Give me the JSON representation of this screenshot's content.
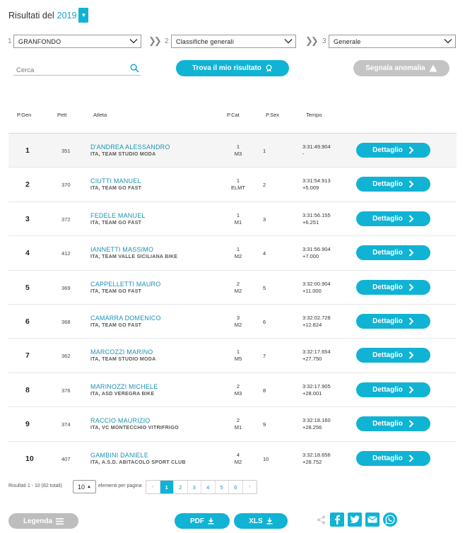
{
  "header": {
    "title": "Risultati del",
    "year": "2019"
  },
  "filters": [
    {
      "step": "1",
      "value": "GRANFONDO"
    },
    {
      "step": "2",
      "value": "Classifiche generali"
    },
    {
      "step": "3",
      "value": "Generale"
    }
  ],
  "search": {
    "placeholder": "Cerca"
  },
  "actions": {
    "find_label": "Trova il mio risultato",
    "report_label": "Segnala anomalia"
  },
  "columns": {
    "pgen": "P.Gen",
    "pett": "Pett",
    "athlete": "Atleta",
    "pcat": "P.Cat",
    "psex": "P.Sex",
    "time": "Tempo"
  },
  "rows": [
    {
      "pos": "1",
      "pett": "351",
      "name": "D'ANDREA ALESSANDRO",
      "team": "ITA, TEAM STUDIO MODA",
      "pcat": "1",
      "cat": "M3",
      "psex": "1",
      "time": "3:31:49.904",
      "gap": "-"
    },
    {
      "pos": "2",
      "pett": "370",
      "name": "CIUTTI MANUEL",
      "team": "ITA, TEAM GO FAST",
      "pcat": "1",
      "cat": "ELMT",
      "psex": "2",
      "time": "3:31:54.913",
      "gap": "+5.009"
    },
    {
      "pos": "3",
      "pett": "372",
      "name": "FEDELE MANUEL",
      "team": "ITA, TEAM GO FAST",
      "pcat": "1",
      "cat": "M1",
      "psex": "3",
      "time": "3:31:56.155",
      "gap": "+6.251"
    },
    {
      "pos": "4",
      "pett": "412",
      "name": "IANNETTI MASSIMO",
      "team": "ITA, TEAM VALLE SICILIANA BIKE",
      "pcat": "1",
      "cat": "M2",
      "psex": "4",
      "time": "3:31:56.904",
      "gap": "+7.000"
    },
    {
      "pos": "5",
      "pett": "369",
      "name": "CAPPELLETTI MAURO",
      "team": "ITA, TEAM GO FAST",
      "pcat": "2",
      "cat": "M2",
      "psex": "5",
      "time": "3:32:00.904",
      "gap": "+11.000"
    },
    {
      "pos": "6",
      "pett": "368",
      "name": "CAMARRA DOMENICO",
      "team": "ITA, TEAM GO FAST",
      "pcat": "3",
      "cat": "M2",
      "psex": "6",
      "time": "3:32:02.728",
      "gap": "+12.824"
    },
    {
      "pos": "7",
      "pett": "362",
      "name": "MARCOZZI MARINO",
      "team": "ITA, TEAM STUDIO MODA",
      "pcat": "1",
      "cat": "M5",
      "psex": "7",
      "time": "3:32:17.654",
      "gap": "+27.750"
    },
    {
      "pos": "8",
      "pett": "376",
      "name": "MARINOZZI MICHELE",
      "team": "ITA, ASD VEREGRA BIKE",
      "pcat": "2",
      "cat": "M3",
      "psex": "8",
      "time": "3:32:17.905",
      "gap": "+28.001"
    },
    {
      "pos": "9",
      "pett": "374",
      "name": "RACCIO MAURIZIO",
      "team": "ITA, VC MONTECCHIO VITRIFRIGO",
      "pcat": "2",
      "cat": "M1",
      "psex": "9",
      "time": "3:32:18.160",
      "gap": "+28.256"
    },
    {
      "pos": "10",
      "pett": "407",
      "name": "GAMBINI DANIELE",
      "team": "ITA, A.S.D. ABITACOLO SPORT CLUB",
      "pcat": "4",
      "cat": "M2",
      "psex": "10",
      "time": "3:32:18.656",
      "gap": "+28.752"
    }
  ],
  "detail_label": "Dettaglio",
  "pagination": {
    "info": "Risultati 1 - 10 (82 totali)",
    "per_page": "10",
    "per_page_label": "elementi per pagina",
    "prev": "‹",
    "next": "›",
    "pages": [
      "1",
      "2",
      "3",
      "4",
      "5",
      "6"
    ],
    "current": "1"
  },
  "footer": {
    "legend_label": "Legenda",
    "pdf_label": "PDF",
    "xls_label": "XLS"
  },
  "colors": {
    "accent": "#10b3d4",
    "link": "#1a93b4",
    "disabled": "#c4c4c4"
  }
}
